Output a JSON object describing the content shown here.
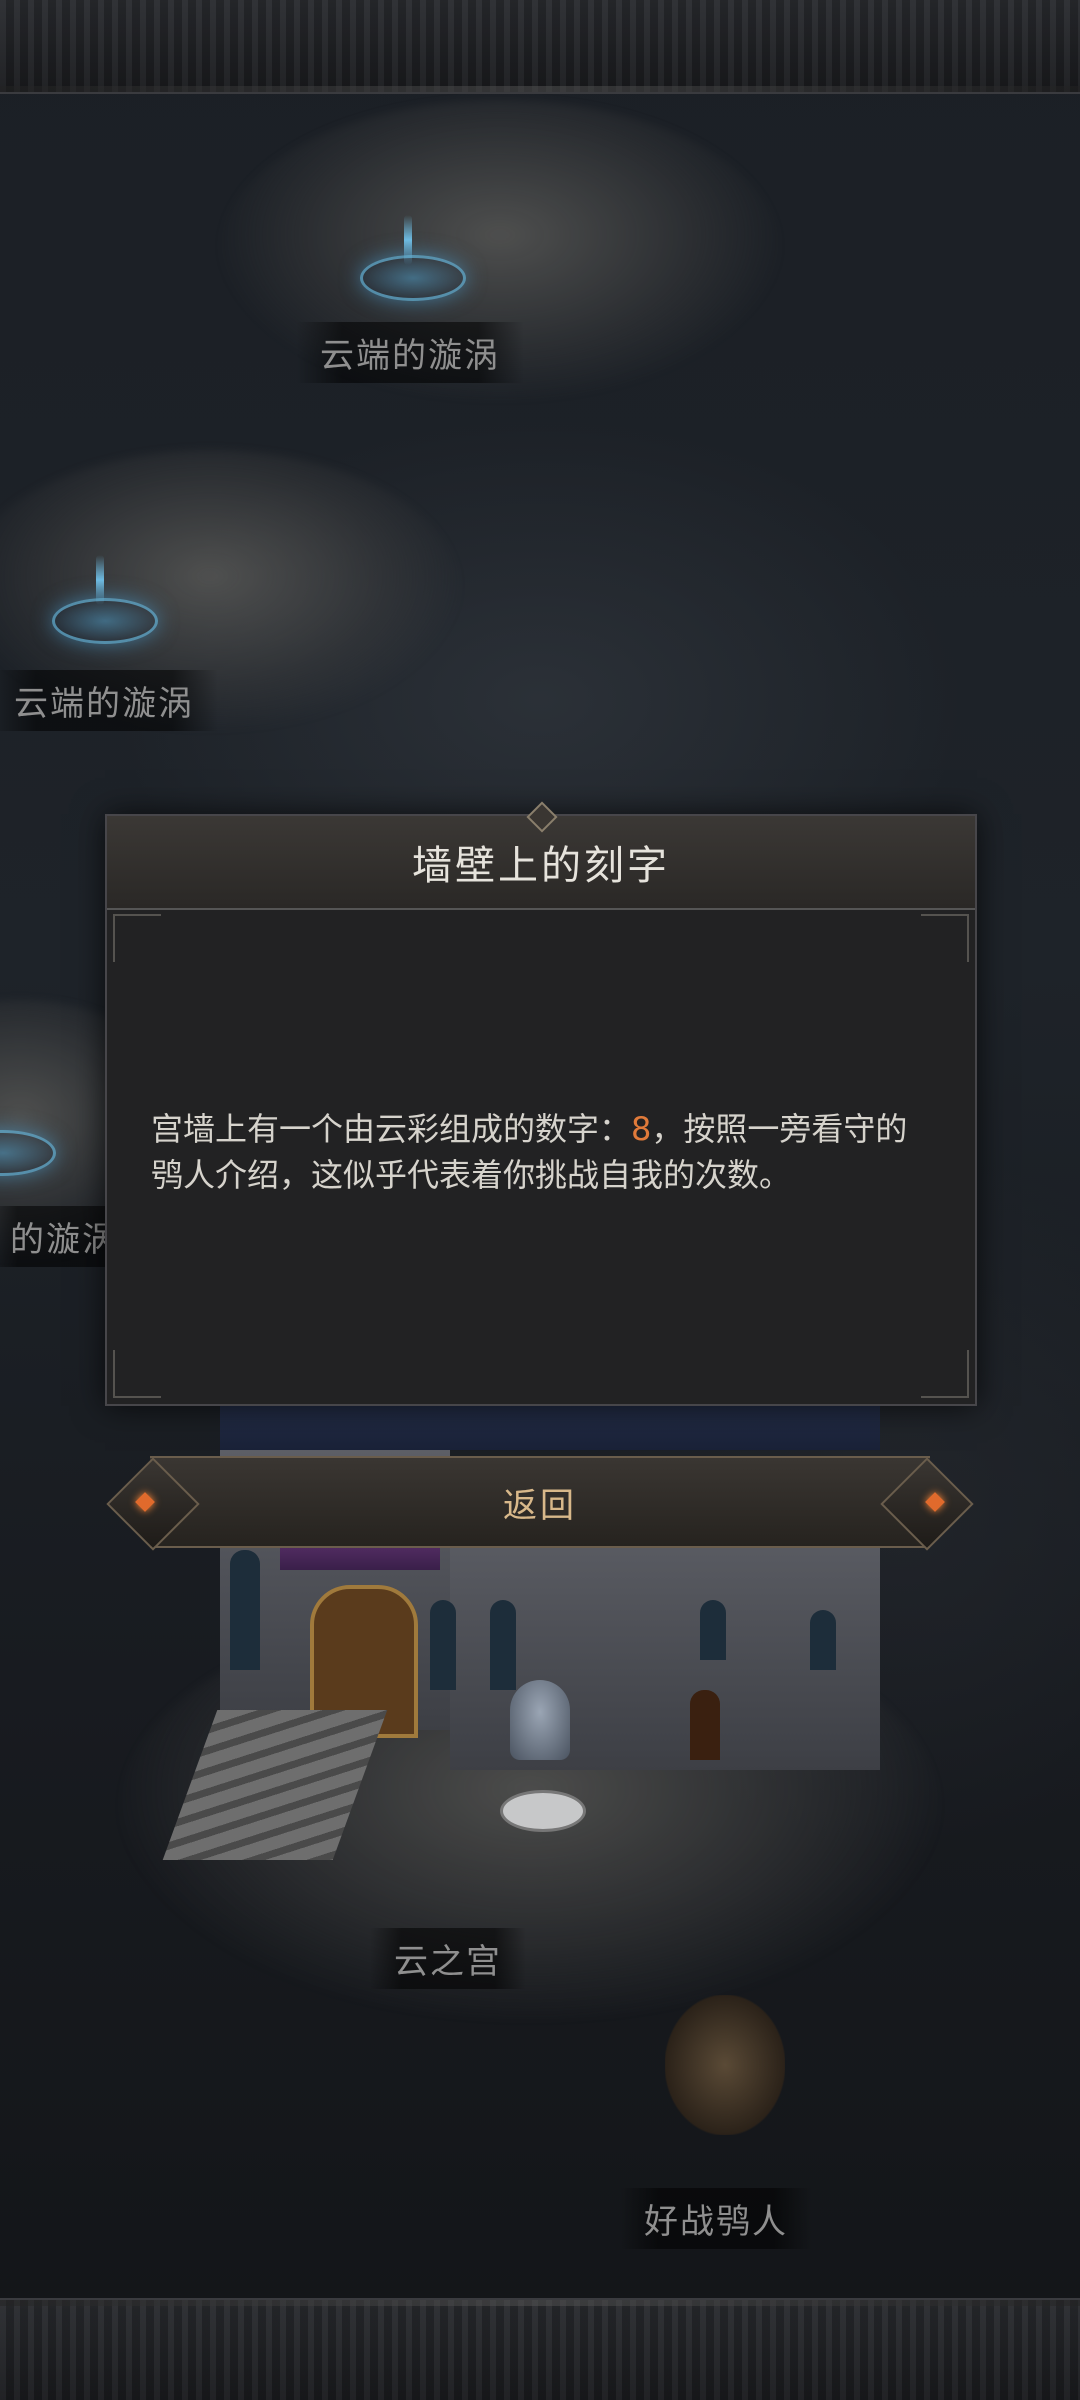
{
  "map": {
    "locations": [
      {
        "label": "云端的漩涡"
      },
      {
        "label": "云端的漩涡"
      },
      {
        "label": "的漩涡"
      },
      {
        "label": "云之宫"
      },
      {
        "label": "好战鸮人"
      }
    ]
  },
  "dialog": {
    "title": "墙壁上的刻字",
    "body_before": "宫墙上有一个由云彩组成的数字：",
    "number": "8",
    "body_after": "，按照一旁看守的鸮人介绍，这似乎代表着你挑战自我的次数。",
    "highlight_color": "#e07a3a"
  },
  "buttons": {
    "return_label": "返回"
  }
}
